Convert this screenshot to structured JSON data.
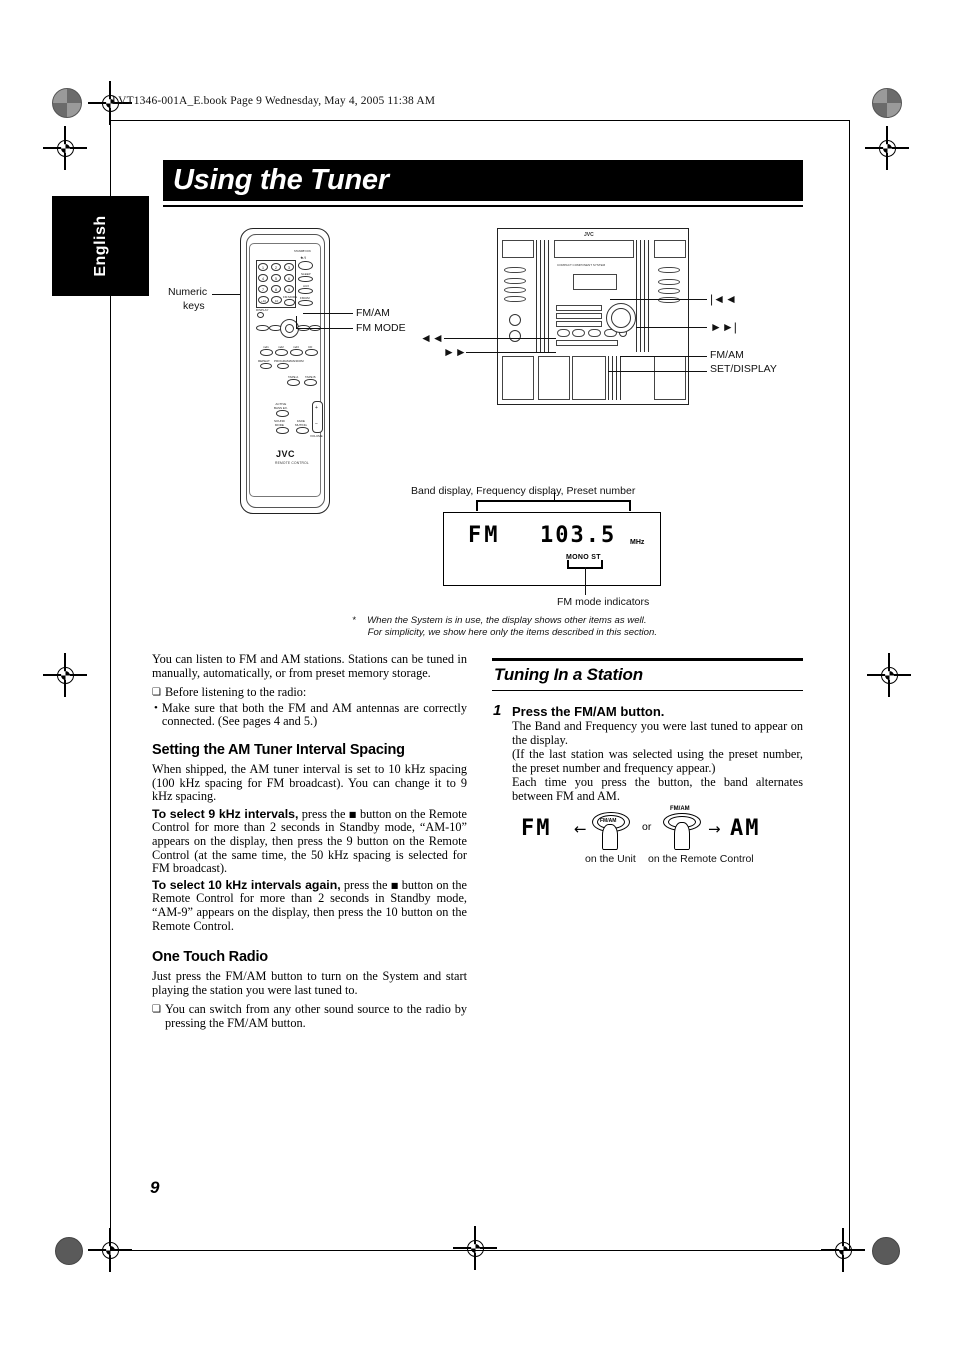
{
  "header": {
    "book_line": "LVT1346-001A_E.book  Page 9  Wednesday, May 4, 2005  11:38 AM"
  },
  "language_tab": {
    "label": "English"
  },
  "title": {
    "text": "Using the Tuner"
  },
  "page_number": "9",
  "figures": {
    "remote": {
      "callouts": [
        {
          "id": "numeric-keys",
          "line1": "Numeric",
          "line2": "keys"
        },
        {
          "id": "fm-am",
          "label": "FM/AM"
        },
        {
          "id": "fm-mode",
          "label": "FM MODE"
        }
      ],
      "brand": "JVC",
      "sub_brand": "REMOTE CONTROL",
      "standby_label": "STANDBY/ON",
      "keys": [
        "1",
        "2",
        "3",
        "4",
        "5",
        "6",
        "7",
        "8",
        "9",
        "+10",
        "10"
      ],
      "side_keys": [
        "SLEEP",
        "AUX",
        "FM/AM"
      ],
      "fm_mode_label": "FM MODE",
      "display_label": "DISPLAY",
      "source_keys": [
        "md1",
        "md2",
        "md3",
        "CD 1-10"
      ],
      "program_keys": [
        "REPEAT",
        "PROGRAM/RANDOM"
      ],
      "tape_keys": [
        "TAPE A",
        "TAPE B"
      ],
      "sound_keys": [
        "ACTIVE BASS EX.",
        "SOUND MODE",
        "FADE MUTING"
      ],
      "volume_label": "VOLUME"
    },
    "unit": {
      "callouts_left": [
        {
          "id": "rew",
          "label": "◄◄"
        },
        {
          "id": "ff",
          "label": "►►"
        }
      ],
      "callouts_right": [
        {
          "id": "prev",
          "label": "|◄◄"
        },
        {
          "id": "next",
          "label": "►►|"
        },
        {
          "id": "fm-am",
          "label": "FM/AM"
        },
        {
          "id": "set-display",
          "label": "SET/DISPLAY"
        }
      ],
      "brand": "JVC",
      "model_text": "COMPACT COMPONENT SYSTEM"
    },
    "display": {
      "top_label": "Band display, Frequency display, Preset number",
      "bottom_label": "FM mode indicators",
      "band": "FM",
      "frequency": "103.5",
      "unit": "MHz",
      "indicators": "MONO ST"
    },
    "footnote": {
      "marker": "*",
      "line1": "When the System is in use, the display shows other items as well.",
      "line2": "For simplicity, we show here only the items described in this section."
    }
  },
  "left_column": {
    "intro": "You can listen to FM and AM stations. Stations can be tuned in manually, automatically, or from preset memory storage.",
    "before_heading": "Before listening to the radio:",
    "before_bullet": "Make sure that both the FM and AM antennas are correctly connected. (See pages 4 and 5.)",
    "section1": {
      "heading": "Setting the AM Tuner Interval Spacing",
      "para1": "When shipped, the AM tuner interval is set to 10 kHz spacing (100 kHz spacing for FM broadcast). You can change it to 9 kHz spacing.",
      "bold1": "To select 9 kHz intervals,",
      "text1_a": " press the ",
      "text1_b": " button on the Remote Control for more than 2 seconds in Standby mode, “AM-10” appears on the display, then press the 9 button on the Remote Control (at the same time, the 50 kHz spacing is selected for FM broadcast).",
      "bold2": "To select 10 kHz intervals again,",
      "text2_a": " press the ",
      "text2_b": " button on the Remote Control for more than 2 seconds in Standby mode, “AM-9” appears on the display, then press the 10 button on the Remote Control."
    },
    "section2": {
      "heading": "One Touch Radio",
      "para1": "Just press the FM/AM button to turn on the System and start playing the station you were last tuned to.",
      "bullet1": "You can switch from any other sound source to the radio by pressing the FM/AM button."
    }
  },
  "right_column": {
    "heading": "Tuning In a Station",
    "step1": {
      "number": "1",
      "title": "Press the FM/AM button.",
      "para1": "The Band and Frequency you were last tuned to appear on the display.",
      "para2": "(If the last station was selected using the preset number, the preset number and frequency appear.)",
      "para3": "Each time you press the button, the band alternates between FM and AM."
    },
    "diagram": {
      "left_band": "FM",
      "right_band": "AM",
      "button_label": "FM/AM",
      "or_text": "or",
      "caption_unit": "on the Unit",
      "caption_remote": "on the Remote Control"
    }
  }
}
